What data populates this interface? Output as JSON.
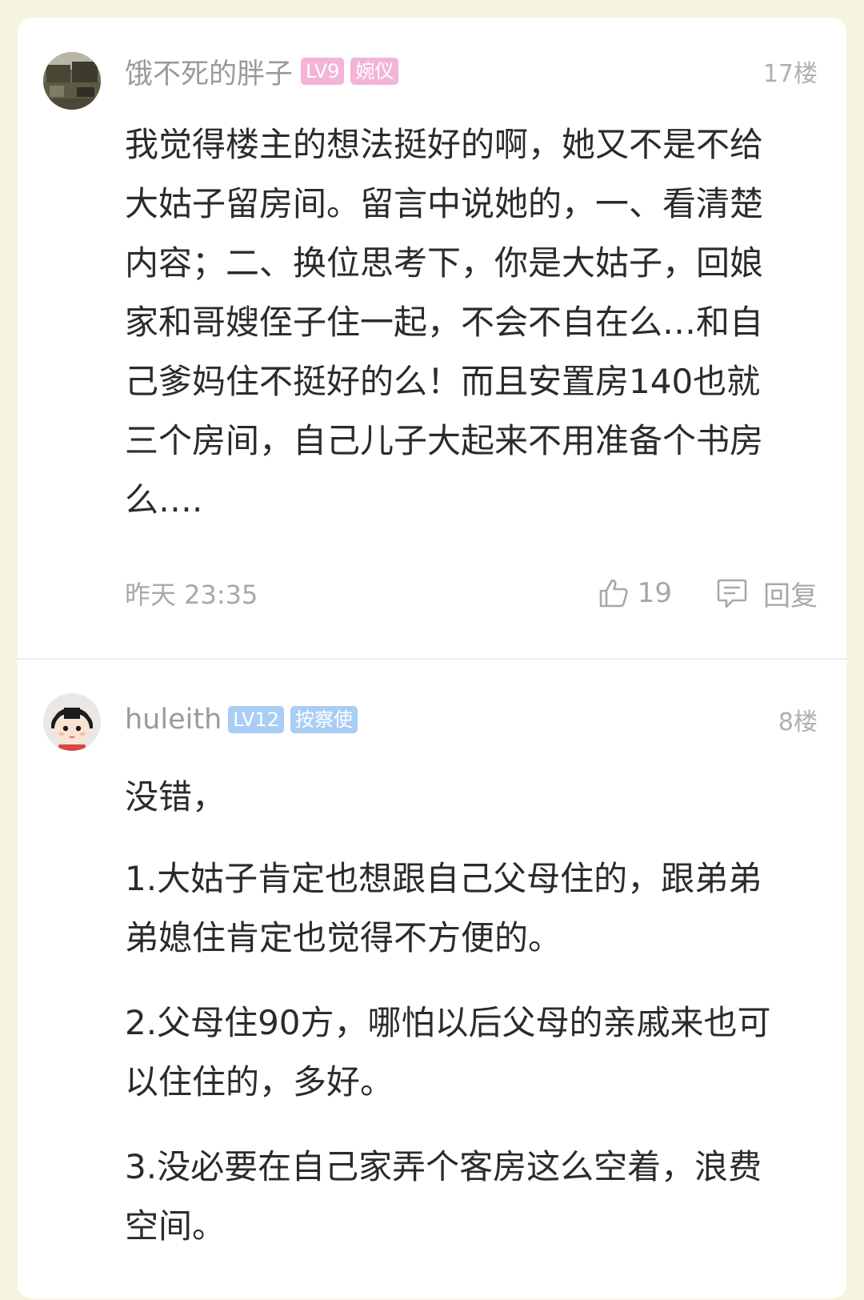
{
  "posts": [
    {
      "username": "饿不死的胖子",
      "level": "LV9",
      "title": "婉仪",
      "floor": "17楼",
      "content": [
        "我觉得楼主的想法挺好的啊，她又不是不给大姑子留房间。留言中说她的，一、看清楚内容；二、换位思考下，你是大姑子，回娘家和哥嫂侄子住一起，不会不自在么…和自己爹妈住不挺好的么！而且安置房140也就三个房间，自己儿子大起来不用准备个书房么…."
      ],
      "time": "昨天 23:35",
      "likes": "19",
      "reply_label": "回复",
      "colors": {
        "title_badge": "#f3b4d8"
      }
    },
    {
      "username": "huleith",
      "level": "LV12",
      "title": "按察使",
      "floor": "8楼",
      "content": [
        "没错，",
        "1.大姑子肯定也想跟自己父母住的，跟弟弟弟媳住肯定也觉得不方便的。",
        "2.父母住90方，哪怕以后父母的亲戚来也可以住住的，多好。",
        "3.没必要在自己家弄个客房这么空着，浪费空间。"
      ],
      "colors": {
        "title_badge": "#a9cdf4"
      }
    }
  ],
  "icons": {
    "like": "thumbs-up-icon",
    "reply": "comment-icon"
  }
}
